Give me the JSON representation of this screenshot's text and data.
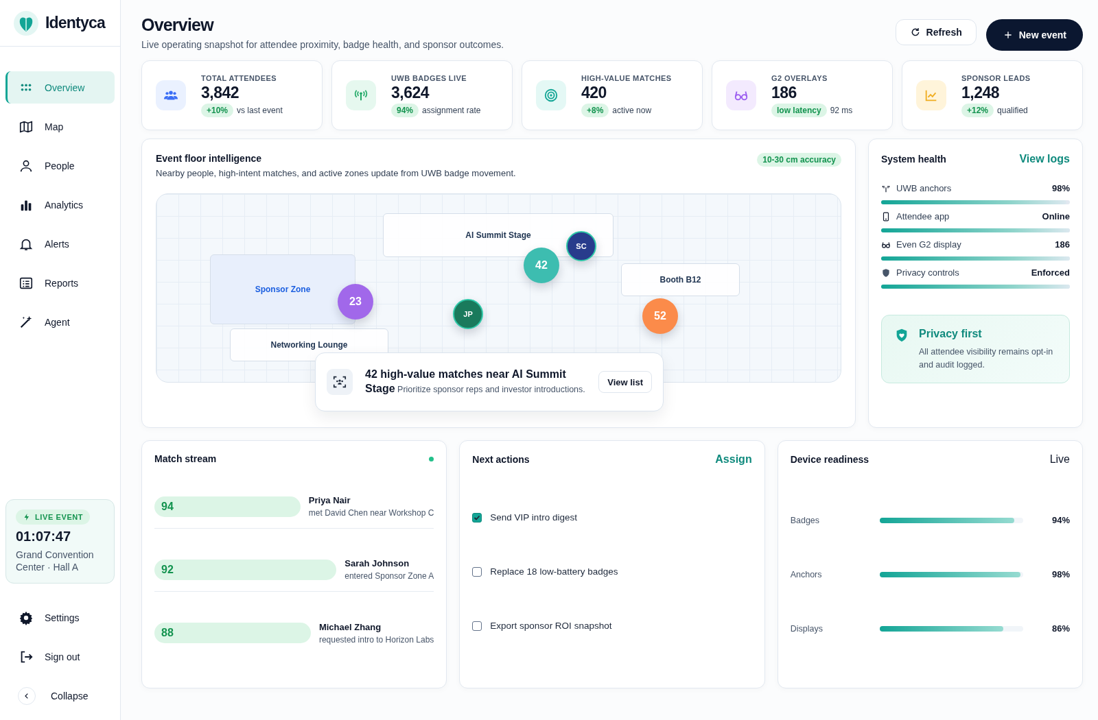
{
  "brand": {
    "name": "Identyca"
  },
  "nav": [
    {
      "label": "Overview",
      "selected": true
    },
    {
      "label": "Map",
      "selected": false
    },
    {
      "label": "People",
      "selected": false
    },
    {
      "label": "Analytics",
      "selected": false
    },
    {
      "label": "Alerts",
      "selected": false
    },
    {
      "label": "Reports",
      "selected": false
    },
    {
      "label": "Agent",
      "selected": false
    }
  ],
  "live_event": {
    "badge": "LIVE EVENT",
    "timer": "01:07:47",
    "venue": "Grand Convention Center · Hall A"
  },
  "footer_nav": [
    {
      "label": "Settings"
    },
    {
      "label": "Sign out"
    },
    {
      "label": "Collapse"
    }
  ],
  "header": {
    "title": "Overview",
    "subtitle": "Live operating snapshot for attendee proximity, badge health, and sponsor outcomes.",
    "buttons": [
      {
        "label": "Refresh",
        "kind": "secondary"
      },
      {
        "label": "New event",
        "kind": "primary"
      }
    ]
  },
  "stats": [
    {
      "label": "TOTAL ATTENDEES",
      "value": "3,842",
      "badge": "+10%",
      "note": "vs last event"
    },
    {
      "label": "UWB BADGES LIVE",
      "value": "3,624",
      "badge": "94%",
      "note": "assignment rate"
    },
    {
      "label": "HIGH-VALUE MATCHES",
      "value": "420",
      "badge": "+8%",
      "note": "active now"
    },
    {
      "label": "G2 OVERLAYS",
      "value": "186",
      "badge": "low latency",
      "note": "92 ms"
    },
    {
      "label": "SPONSOR LEADS",
      "value": "1,248",
      "badge": "+12%",
      "note": "qualified"
    }
  ],
  "floor": {
    "title": "Event floor intelligence",
    "subtitle": "Nearby people, high-intent matches, and active zones update from UWB badge movement.",
    "badge": "10-30 cm accuracy",
    "zones": [
      {
        "label": "AI Summit Stage",
        "selected": false
      },
      {
        "label": "Sponsor Zone",
        "selected": true
      },
      {
        "label": "Booth B12",
        "selected": false
      },
      {
        "label": "Networking Lounge",
        "selected": false
      }
    ],
    "markers": [
      {
        "label": "42",
        "kind": "cluster",
        "color": "#3dbdb0"
      },
      {
        "label": "SC",
        "kind": "person",
        "color": "#283c8c"
      },
      {
        "label": "23",
        "kind": "cluster",
        "color": "#a168ea"
      },
      {
        "label": "JP",
        "kind": "person",
        "color": "#1a7a5c"
      },
      {
        "label": "52",
        "kind": "cluster",
        "color": "#fb8b4a"
      }
    ],
    "callout": {
      "title": "42 high-value matches near AI Summit Stage",
      "text": "Prioritize sponsor reps and investor introductions.",
      "button": "View list"
    }
  },
  "system_health": {
    "title": "System health",
    "link": "View logs",
    "rows": [
      {
        "label": "UWB anchors",
        "value": "98%",
        "level": 0.98
      },
      {
        "label": "Attendee app",
        "value": "Online",
        "level": 1
      },
      {
        "label": "Even G2 display",
        "value": "186",
        "level": 1
      },
      {
        "label": "Privacy controls",
        "value": "Enforced",
        "level": 1
      }
    ],
    "notice": {
      "title": "Privacy first",
      "text": "All attendee visibility remains opt-in and audit logged."
    }
  },
  "match_stream": {
    "title": "Match stream",
    "rows": [
      {
        "score": "94",
        "name": "Priya Nair",
        "detail": "met David Chen near Workshop C"
      },
      {
        "score": "92",
        "name": "Sarah Johnson",
        "detail": "entered Sponsor Zone A"
      },
      {
        "score": "88",
        "name": "Michael Zhang",
        "detail": "requested intro to Horizon Labs"
      }
    ]
  },
  "next_actions": {
    "title": "Next actions",
    "link": "Assign",
    "items": [
      {
        "label": "Send VIP intro digest",
        "checked": true
      },
      {
        "label": "Replace 18 low-battery badges",
        "checked": false
      },
      {
        "label": "Export sponsor ROI snapshot",
        "checked": false
      }
    ]
  },
  "device_readiness": {
    "title": "Device readiness",
    "status": "Live",
    "rows": [
      {
        "label": "Badges",
        "value": "94%",
        "level": 0.94
      },
      {
        "label": "Anchors",
        "value": "98%",
        "level": 0.98
      },
      {
        "label": "Displays",
        "value": "86%",
        "level": 0.86
      }
    ]
  }
}
